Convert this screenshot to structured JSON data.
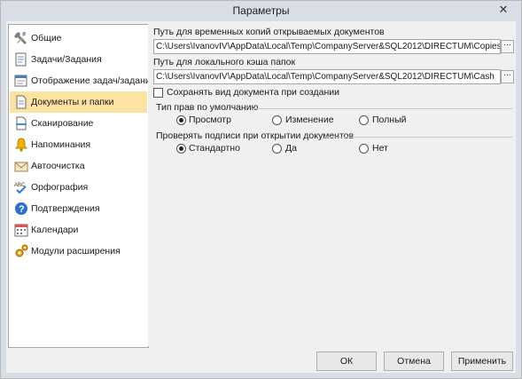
{
  "window": {
    "title": "Параметры",
    "close_glyph": "✕"
  },
  "sidebar": {
    "items": [
      {
        "label": "Общие",
        "icon": "tools-icon"
      },
      {
        "label": "Задачи/Задания",
        "icon": "tasks-icon"
      },
      {
        "label": "Отображение задач/заданий",
        "icon": "task-view-icon"
      },
      {
        "label": "Документы и папки",
        "icon": "document-icon"
      },
      {
        "label": "Сканирование",
        "icon": "scanner-icon"
      },
      {
        "label": "Напоминания",
        "icon": "bell-icon"
      },
      {
        "label": "Автоочистка",
        "icon": "envelope-icon"
      },
      {
        "label": "Орфография",
        "icon": "spellcheck-icon"
      },
      {
        "label": "Подтверждения",
        "icon": "question-icon"
      },
      {
        "label": "Календари",
        "icon": "calendar-icon"
      },
      {
        "label": "Модули расширения",
        "icon": "gears-icon"
      }
    ],
    "selected": "Документы и папки"
  },
  "content": {
    "temp_label": "Путь для временных копий открываемых документов",
    "temp_path": "C:\\Users\\IvanovIV\\AppData\\Local\\Temp\\CompanyServer&SQL2012\\DIRECTUM\\Copies",
    "cache_label": "Путь для локального кэша папок",
    "cache_path": "C:\\Users\\IvanovIV\\AppData\\Local\\Temp\\CompanyServer&SQL2012\\DIRECTUM\\Cash",
    "browse_glyph": "···",
    "save_view_label": "Сохранять вид документа при создании",
    "save_view_checked": false,
    "rights_group": "Тип прав по умолчанию",
    "rights_options": [
      "Просмотр",
      "Изменение",
      "Полный"
    ],
    "rights_selected": "Просмотр",
    "sign_group": "Проверять подписи при открытии документов",
    "sign_options": [
      "Стандартно",
      "Да",
      "Нет"
    ],
    "sign_selected": "Стандартно"
  },
  "buttons": {
    "ok": "ОК",
    "cancel": "Отмена",
    "apply": "Применить"
  }
}
